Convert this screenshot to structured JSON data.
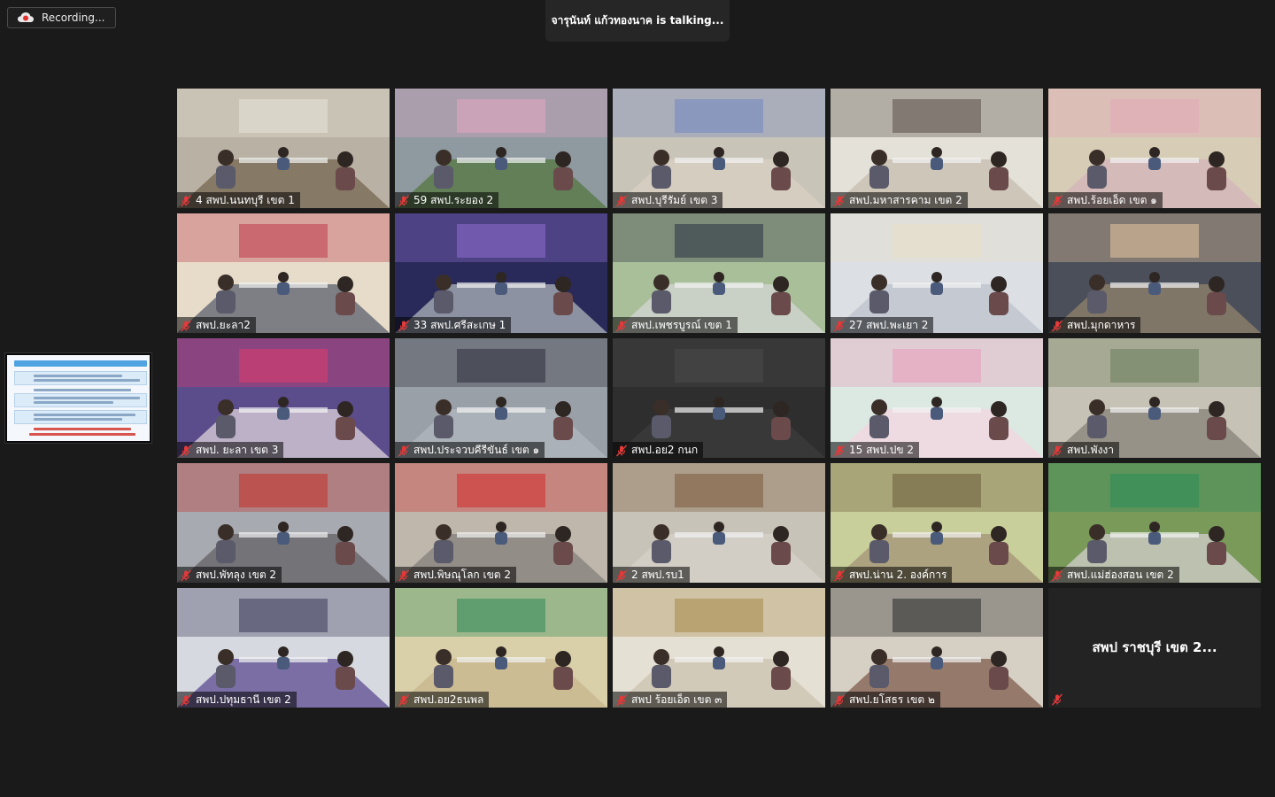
{
  "recording": {
    "label": "Recording...",
    "icon": "cloud-record-icon"
  },
  "active_speaker": {
    "text": "จารุนันท์ แก้วทองนาค is  talking..."
  },
  "share_thumbnail": {
    "icon": "shared-screen-thumbnail"
  },
  "participants": [
    {
      "name": "4 สพป.นนทบุรี เขต 1",
      "muted": true,
      "video": true,
      "bg": "#b9b2a4",
      "accent": "#e8e3d8",
      "floor": "#7d6f5c"
    },
    {
      "name": "59 สพป.ระยอง 2",
      "muted": true,
      "video": true,
      "bg": "#8e9aa0",
      "accent": "#e3a7c2",
      "floor": "#5a7a4a"
    },
    {
      "name": "สพป.บุรีรัมย์ เขต 3",
      "muted": true,
      "video": true,
      "bg": "#c9c4b8",
      "accent": "#6f87c0",
      "floor": "#d8cfc2"
    },
    {
      "name": "สพป.มหาสารคาม เขต 2",
      "muted": true,
      "video": true,
      "bg": "#e4e1d8",
      "accent": "#5a5048",
      "floor": "#c9c1b4"
    },
    {
      "name": "สพป.ร้อยเอ็ด เขต ๑",
      "muted": true,
      "video": true,
      "bg": "#d7ccb5",
      "accent": "#e2a7b8",
      "floor": "#d4b6ba"
    },
    {
      "name": "สพป.ยะลา2",
      "muted": true,
      "video": true,
      "bg": "#e6dcc9",
      "accent": "#c03a4a",
      "floor": "#6a6f78"
    },
    {
      "name": "33 สพป.ศรีสะเกษ 1",
      "muted": true,
      "video": true,
      "bg": "#2a2a5a",
      "accent": "#8f6fd0",
      "floor": "#9fa4b0"
    },
    {
      "name": "สพป.เพชรบูรณ์ เขต 1",
      "muted": true,
      "video": true,
      "bg": "#a9bf9a",
      "accent": "#2a3140",
      "floor": "#cfd2cc"
    },
    {
      "name": "27 สพป.พะเยา 2",
      "muted": true,
      "video": true,
      "bg": "#dcdfe4",
      "accent": "#e7dfc5",
      "floor": "#bfc6cf"
    },
    {
      "name": "สพป.มุกดาหาร",
      "muted": true,
      "video": true,
      "bg": "#4a4f5a",
      "accent": "#e7c9a0",
      "floor": "#8a7c6a"
    },
    {
      "name": "สพป. ยะลา เขต 3",
      "muted": true,
      "video": true,
      "bg": "#5b4c8c",
      "accent": "#e23a6a",
      "floor": "#cfc3d2"
    },
    {
      "name": "สพป.ประจวบคีรีขันธ์ เขต ๑",
      "muted": true,
      "video": true,
      "bg": "#9aa0a8",
      "accent": "#2e2e3a",
      "floor": "#aeb4bb"
    },
    {
      "name": "สพป.อย2 กนก",
      "muted": true,
      "video": true,
      "bg": "#2e2e2e",
      "accent": "#4a4a4a",
      "floor": "#3a3a3a"
    },
    {
      "name": "15 สพป.ปข 2",
      "muted": true,
      "video": true,
      "bg": "#dce9e3",
      "accent": "#e79ab8",
      "floor": "#f0d8e0"
    },
    {
      "name": "สพป.พังงา",
      "muted": true,
      "video": true,
      "bg": "#c6c3b6",
      "accent": "#6a7c5a",
      "floor": "#8d8a80"
    },
    {
      "name": "สพป.พัทลุง เขต 2",
      "muted": true,
      "video": true,
      "bg": "#a7aab0",
      "accent": "#c4302a",
      "floor": "#6a6a6e"
    },
    {
      "name": "สพป.พิษณุโลก เขต 2",
      "muted": true,
      "video": true,
      "bg": "#bfb7ac",
      "accent": "#d22a2a",
      "floor": "#8a8680"
    },
    {
      "name": "2 สพป.รบ1",
      "muted": true,
      "video": true,
      "bg": "#c8c3b8",
      "accent": "#7a5a3a",
      "floor": "#d5d0c7"
    },
    {
      "name": "สพป.น่าน 2. องค์การ",
      "muted": true,
      "video": true,
      "bg": "#c9cf9a",
      "accent": "#6a5a3a",
      "floor": "#a89a7a"
    },
    {
      "name": "สพป.แม่ฮ่องสอน เขต 2",
      "muted": true,
      "video": true,
      "bg": "#7a9a5a",
      "accent": "#2a8a5a",
      "floor": "#c8c8c0"
    },
    {
      "name": "สพป.ปทุมธานี เขต 2",
      "muted": true,
      "video": true,
      "bg": "#d6d9df",
      "accent": "#3a3a5a",
      "floor": "#6a5a9a"
    },
    {
      "name": "สพป.อย2ธนพล",
      "muted": true,
      "video": true,
      "bg": "#d9cfa8",
      "accent": "#2e8a5a",
      "floor": "#c8b890"
    },
    {
      "name": "สพป ร้อยเอ็ด เขต ๓",
      "muted": true,
      "video": true,
      "bg": "#e5e0d4",
      "accent": "#a88a4a",
      "floor": "#cfc6b4"
    },
    {
      "name": "สพป.ยโสธร เขต ๒",
      "muted": true,
      "video": true,
      "bg": "#d6cfc4",
      "accent": "#2a2a2a",
      "floor": "#8a6a5a"
    },
    {
      "name": "สพป ราชบุรี เขต 2...",
      "muted": true,
      "video": false
    }
  ]
}
